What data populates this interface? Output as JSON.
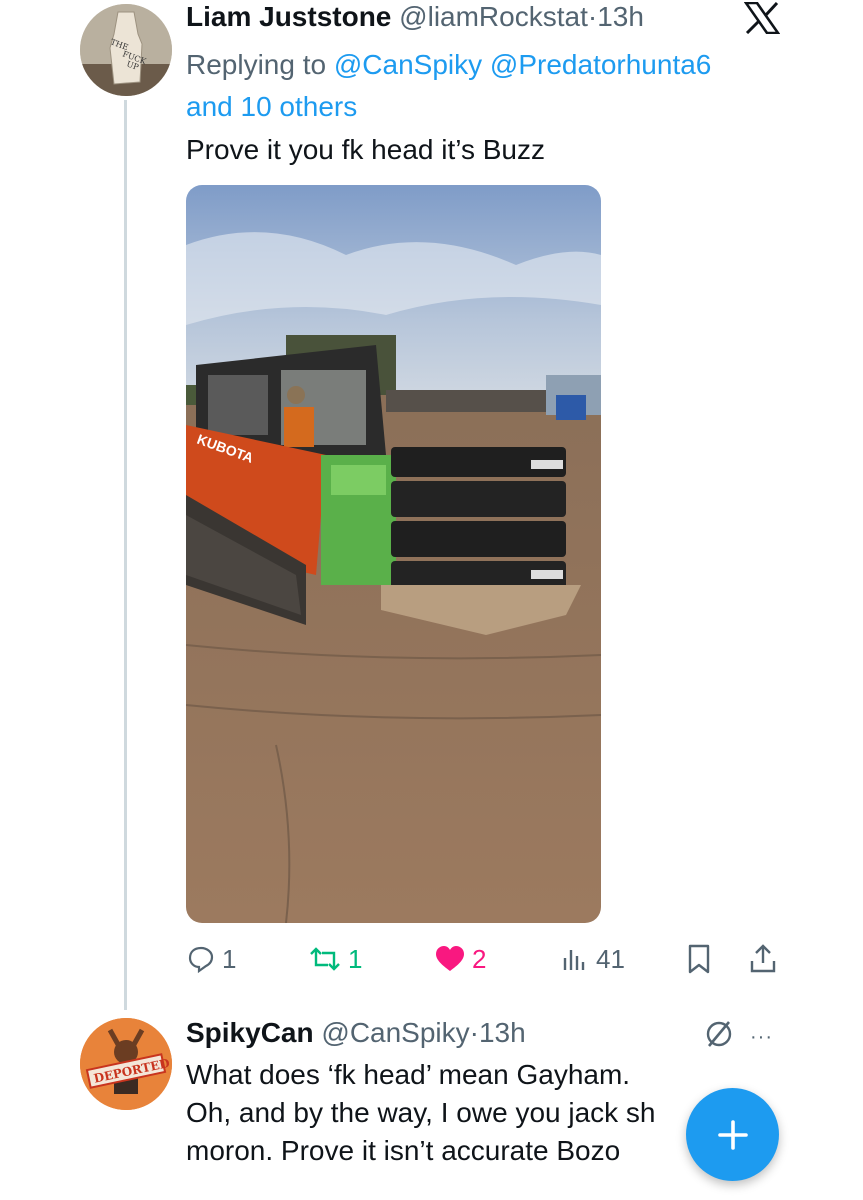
{
  "tweet1": {
    "author_name": "Liam Juststone",
    "handle": "@liamRockstat",
    "separator": "·",
    "time": "13h",
    "replying_prefix": "Replying to ",
    "mention1": "@CanSpiky",
    "mention2": "@Predatorhunta6",
    "and_others": "and 10 others",
    "text": "Prove it you fk head it’s Buzz",
    "avatar_text": [
      "THE",
      "FUCK",
      "UP"
    ],
    "media_text": "KUBOTA",
    "counts": {
      "replies": "1",
      "reposts": "1",
      "likes": "2",
      "views": "41"
    },
    "icons": [
      "reply-icon",
      "repost-icon",
      "like-icon",
      "views-icon",
      "bookmark-icon",
      "share-icon"
    ]
  },
  "tweet2": {
    "author_name": "SpikyCan",
    "handle": "@CanSpiky",
    "separator": "·",
    "time": "13h",
    "avatar_text": "DEPORTED",
    "lines": [
      "What does ‘fk head’ mean Gayham.",
      "Oh, and by the way, I owe you jack sh",
      "moron. Prove it isn’t accurate Bozo"
    ],
    "more": "···"
  },
  "colors": {
    "accent": "#1d9bf0",
    "muted": "#536471",
    "repost": "#00ba7c",
    "like": "#f91880",
    "text": "#0f1419",
    "line": "#cfd9de"
  },
  "app_icons": [
    "x-logo-icon",
    "grok-icon",
    "more-icon",
    "compose-plus-icon"
  ]
}
